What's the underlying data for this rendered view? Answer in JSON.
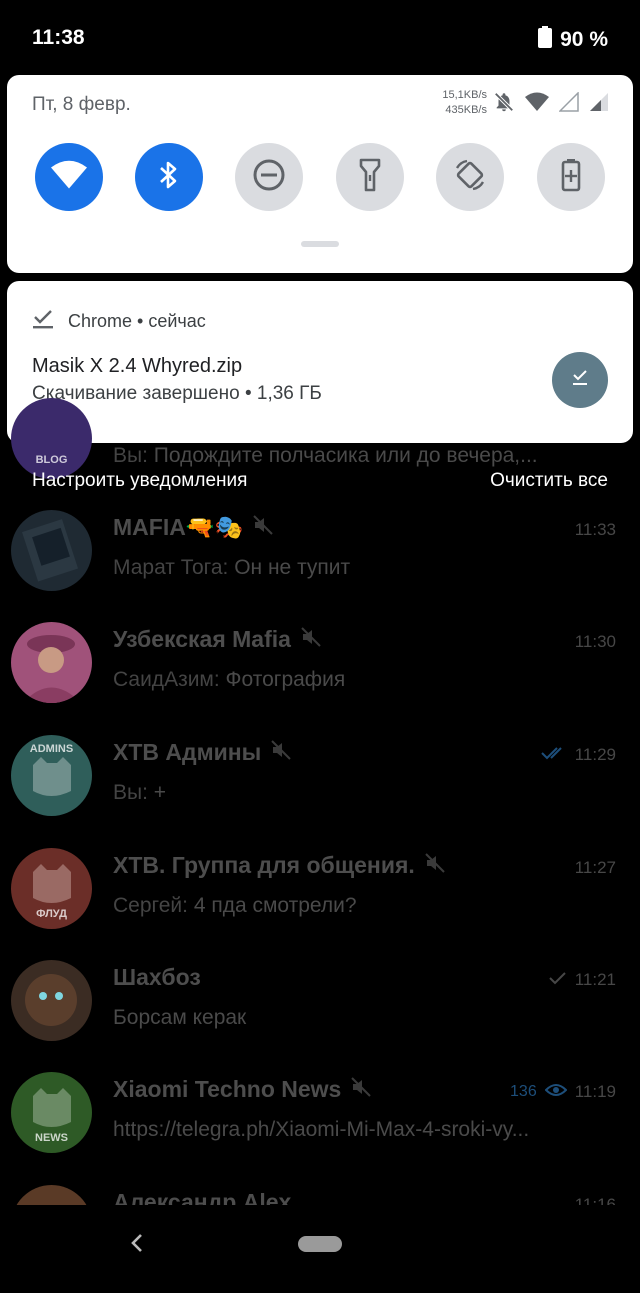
{
  "status_bar": {
    "time": "11:38",
    "battery_percent": "90 %"
  },
  "quick_settings": {
    "date": "Пт, 8 февр.",
    "speed_up": "15,1KB/s",
    "speed_down": "435KB/s",
    "tiles": [
      {
        "name": "wifi",
        "state": "on"
      },
      {
        "name": "bluetooth",
        "state": "on"
      },
      {
        "name": "do-not-disturb",
        "state": "off"
      },
      {
        "name": "flashlight",
        "state": "off"
      },
      {
        "name": "auto-rotate",
        "state": "off"
      },
      {
        "name": "battery-saver",
        "state": "off"
      }
    ],
    "colors": {
      "tile_on": "#1a73e8",
      "tile_off": "#dadce0"
    }
  },
  "notification": {
    "app": "Chrome",
    "separator": " • ",
    "when": "сейчас",
    "title": "Masik X 2.4 Whyred.zip",
    "text": "Скачивание завершено • 1,36 ГБ"
  },
  "shade_footer": {
    "manage": "Настроить уведомления",
    "clear_all": "Очистить все"
  },
  "partial_chat": {
    "avatar_label": "BLOG",
    "sender": "Вы:",
    "message": "Подождите полчасика или до вечера,..."
  },
  "chats": [
    {
      "name": "MAFIA",
      "emoji": "🔫🎭",
      "muted": true,
      "time": "11:33",
      "sender": "Марат Тога:",
      "message": "Он не тупит",
      "avatar_color": "#1f2a33"
    },
    {
      "name": "Узбекская Mafia",
      "muted": true,
      "time": "11:30",
      "sender": "СаидАзим:",
      "message": "Фотография",
      "avatar_color": "#a0527a"
    },
    {
      "name": "XTB Админы",
      "muted": true,
      "time": "11:29",
      "status": "read",
      "sender": "Вы:",
      "message": "+",
      "avatar_label": "ADMINS",
      "avatar_color": "#2f5e5a"
    },
    {
      "name": "XTB. Группа для общения.",
      "muted": true,
      "time": "11:27",
      "sender": "Сергей:",
      "message": "4 пда смотрели?",
      "avatar_label": "ФЛУД",
      "avatar_color": "#6b2e28"
    },
    {
      "name": "Шахбоз",
      "muted": false,
      "time": "11:21",
      "status": "sent",
      "sender": "",
      "message": "Борсам керак",
      "avatar_color": "#3b2c23"
    },
    {
      "name": "Xiaomi Techno News",
      "muted": true,
      "time": "11:19",
      "views": "136",
      "sender": "",
      "message": "https://telegra.ph/Xiaomi-Mi-Max-4-sroki-vy...",
      "avatar_label": "NEWS",
      "avatar_color": "#2e5a26"
    },
    {
      "name": "Александр Alex",
      "muted": false,
      "time": "11:16",
      "sender": "",
      "message": "",
      "avatar_color": "#5a3a26"
    }
  ]
}
